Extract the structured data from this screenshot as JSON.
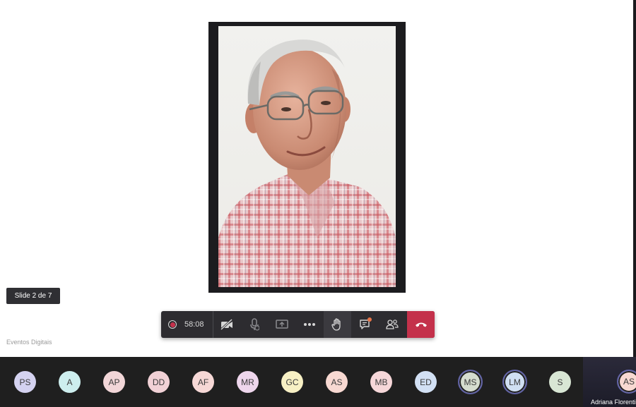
{
  "slide": {
    "counter": "Slide 2 de 7"
  },
  "watermark": "Eventos Digitais",
  "controls": {
    "timer": "58:08",
    "icons": {
      "record": "recording-dot-icon",
      "camera": "camera-off-icon",
      "mic": "mic-muted-icon",
      "share": "share-screen-icon",
      "more": "more-options-icon",
      "hand": "raise-hand-icon",
      "chat": "chat-icon",
      "people": "participants-icon",
      "hangup": "hang-up-icon"
    },
    "hangup_color": "#c4314b",
    "chat_badge_color": "#e97548"
  },
  "participants": [
    {
      "initials": "PS",
      "color": "#d4d2f0"
    },
    {
      "initials": "A",
      "color": "#cdeeee"
    },
    {
      "initials": "AP",
      "color": "#f2d6d8"
    },
    {
      "initials": "DD",
      "color": "#f1d1d6"
    },
    {
      "initials": "AF",
      "color": "#f6d8d6"
    },
    {
      "initials": "MR",
      "color": "#eed6ec"
    },
    {
      "initials": "GC",
      "color": "#f7f0c4"
    },
    {
      "initials": "AS",
      "color": "#f8d9d2"
    },
    {
      "initials": "MB",
      "color": "#f6d7d9"
    },
    {
      "initials": "ED",
      "color": "#d2e0f4"
    },
    {
      "initials": "MS",
      "color": "#d5dccf",
      "ring": true
    },
    {
      "initials": "LM",
      "color": "#d0dff2",
      "ring": true
    },
    {
      "initials": "S",
      "color": "#d8e6d4"
    }
  ],
  "active_speaker": {
    "initials": "AS",
    "name": "Adriana Florentino",
    "color": "#f8d9d2"
  }
}
